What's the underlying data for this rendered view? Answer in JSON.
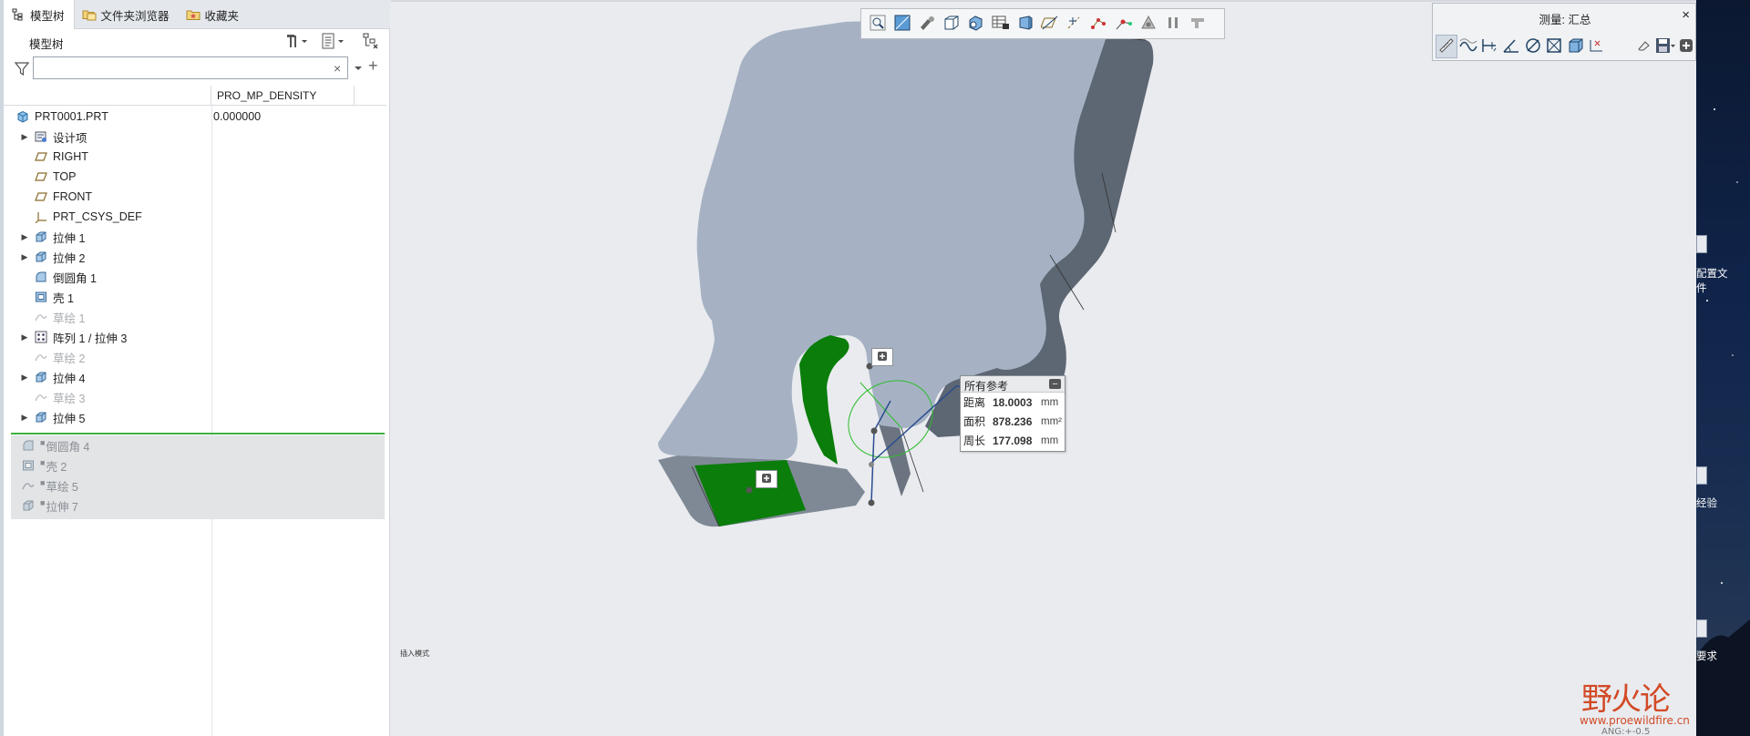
{
  "tabs": [
    {
      "label": "模型树",
      "icon": "tree-icon"
    },
    {
      "label": "文件夹浏览器",
      "icon": "folder-browser-icon"
    },
    {
      "label": "收藏夹",
      "icon": "favorites-icon"
    }
  ],
  "tree": {
    "title": "模型树",
    "filter_value": "",
    "column_header": "PRO_MP_DENSITY",
    "root": {
      "label": "PRT0001.PRT",
      "value": "0.000000"
    },
    "items": [
      {
        "label": "设计项",
        "expandable": true,
        "dim": false,
        "icon": "design-items-icon"
      },
      {
        "label": "RIGHT",
        "expandable": false,
        "dim": false,
        "icon": "datum-plane-icon"
      },
      {
        "label": "TOP",
        "expandable": false,
        "dim": false,
        "icon": "datum-plane-icon"
      },
      {
        "label": "FRONT",
        "expandable": false,
        "dim": false,
        "icon": "datum-plane-icon"
      },
      {
        "label": "PRT_CSYS_DEF",
        "expandable": false,
        "dim": false,
        "icon": "csys-icon"
      },
      {
        "label": "拉伸 1",
        "expandable": true,
        "dim": false,
        "icon": "extrude-icon"
      },
      {
        "label": "拉伸 2",
        "expandable": true,
        "dim": false,
        "icon": "extrude-icon"
      },
      {
        "label": "倒圆角 1",
        "expandable": false,
        "dim": false,
        "icon": "round-icon"
      },
      {
        "label": "壳 1",
        "expandable": false,
        "dim": false,
        "icon": "shell-icon"
      },
      {
        "label": "草绘 1",
        "expandable": false,
        "dim": true,
        "icon": "sketch-icon"
      },
      {
        "label": "阵列 1 / 拉伸 3",
        "expandable": true,
        "dim": false,
        "icon": "pattern-icon"
      },
      {
        "label": "草绘 2",
        "expandable": false,
        "dim": true,
        "icon": "sketch-icon"
      },
      {
        "label": "拉伸 4",
        "expandable": true,
        "dim": false,
        "icon": "extrude-icon"
      },
      {
        "label": "草绘 3",
        "expandable": false,
        "dim": true,
        "icon": "sketch-icon"
      },
      {
        "label": "拉伸 5",
        "expandable": true,
        "dim": false,
        "icon": "extrude-icon"
      }
    ],
    "suppressed": [
      {
        "label": "倒圆角 4",
        "icon": "round-icon"
      },
      {
        "label": "壳 2",
        "icon": "shell-icon"
      },
      {
        "label": "草绘 5",
        "icon": "sketch-icon"
      },
      {
        "label": "拉伸 7",
        "icon": "extrude-icon"
      }
    ]
  },
  "measure": {
    "title": "测量: 汇总",
    "callout_title": "所有参考",
    "rows": [
      {
        "key": "距离",
        "value": "18.0003",
        "unit": "mm"
      },
      {
        "key": "面积",
        "value": "878.236",
        "unit": "mm²"
      },
      {
        "key": "周长",
        "value": "177.098",
        "unit": "mm"
      }
    ]
  },
  "desktop": {
    "items": [
      "配置文",
      "件",
      "经验",
      "要求"
    ]
  },
  "status_text": "插入模式",
  "watermark": {
    "text": "野火论",
    "url": "www.proewildfire.cn",
    "extra": "ANG:+-0.5"
  },
  "colors": {
    "accent_green": "#1e8a1e",
    "model_face": "#a6b2c4",
    "model_side": "#5d6673",
    "highlight": "#0a7d0a"
  }
}
